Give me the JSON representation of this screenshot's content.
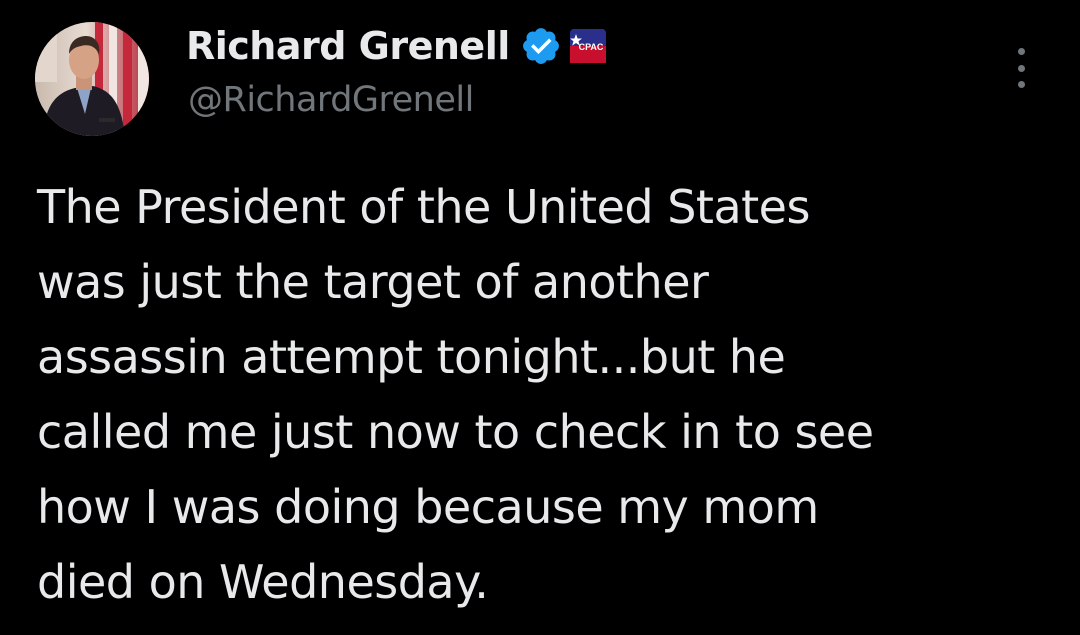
{
  "author": {
    "display_name": "Richard Grenell",
    "handle": "@RichardGrenell",
    "verified": true,
    "verified_badge_color": "#1d9bf0",
    "affiliate_badge_text": "CPAC",
    "affiliate_badge_colors": [
      "#2b2f8c",
      "#c8102e"
    ],
    "avatar_icon": "profile-photo"
  },
  "menu": {
    "icon": "more-options-icon"
  },
  "tweet": {
    "text_lines": [
      "The President of the United States",
      "was just the target of another",
      "assassin attempt tonight...but he",
      "called me just now to check in to see",
      "how I was doing because my mom",
      "died on Wednesday."
    ]
  },
  "theme": {
    "background": "#000000",
    "primary_text": "#e7e9ea",
    "secondary_text": "#71767b"
  }
}
